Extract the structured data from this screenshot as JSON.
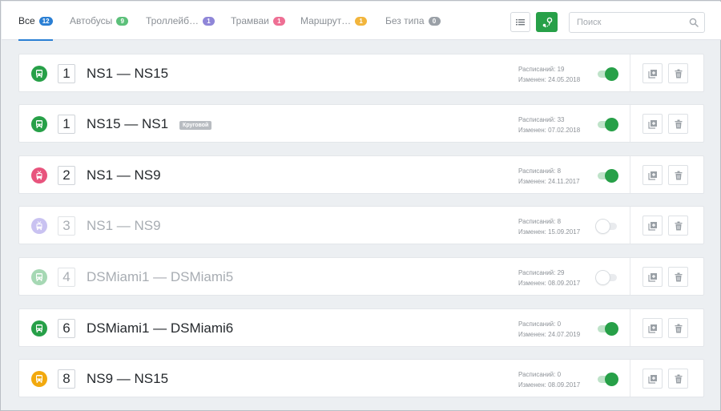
{
  "tabs": [
    {
      "label": "Все",
      "count": "12",
      "badge_color": "#2a7fd4",
      "active": true
    },
    {
      "label": "Автобусы",
      "count": "9",
      "badge_color": "#5cc07a",
      "active": false
    },
    {
      "label": "Троллейб…",
      "count": "1",
      "badge_color": "#8f86d8",
      "active": false
    },
    {
      "label": "Трамваи",
      "count": "1",
      "badge_color": "#ee6f94",
      "active": false
    },
    {
      "label": "Маршрут…",
      "count": "1",
      "badge_color": "#f2b53c",
      "active": false
    },
    {
      "label": "Без типа",
      "count": "0",
      "badge_color": "#9aa0a7",
      "active": false
    }
  ],
  "toolbar": {
    "list_icon": "list-icon",
    "map_icon": "route-map-icon",
    "accent": "#27a048"
  },
  "search": {
    "placeholder": "Поиск",
    "value": "",
    "icon": "search-icon"
  },
  "routes": [
    {
      "type_icon": "bus-icon",
      "type_color": "#27a048",
      "number": "1",
      "title": "NS1 — NS15",
      "tag": "",
      "schedules": "Расписаний: 19",
      "modified": "Изменен: 24.05.2018",
      "enabled": true
    },
    {
      "type_icon": "bus-icon",
      "type_color": "#27a048",
      "number": "1",
      "title": "NS15 — NS1",
      "tag": "Круговой",
      "schedules": "Расписаний: 33",
      "modified": "Изменен: 07.02.2018",
      "enabled": true
    },
    {
      "type_icon": "tram-icon",
      "type_color": "#e8547d",
      "number": "2",
      "title": "NS1 — NS9",
      "tag": "",
      "schedules": "Расписаний: 8",
      "modified": "Изменен: 24.11.2017",
      "enabled": true
    },
    {
      "type_icon": "trolleybus-icon",
      "type_color": "#9d92e6",
      "number": "3",
      "title": "NS1 — NS9",
      "tag": "",
      "schedules": "Расписаний: 8",
      "modified": "Изменен: 15.09.2017",
      "enabled": false
    },
    {
      "type_icon": "bus-icon",
      "type_color": "#5fba78",
      "number": "4",
      "title": "DSMiami1 — DSMiami5",
      "tag": "",
      "schedules": "Расписаний: 29",
      "modified": "Изменен: 08.09.2017",
      "enabled": false
    },
    {
      "type_icon": "bus-icon",
      "type_color": "#27a048",
      "number": "6",
      "title": "DSMiami1 — DSMiami6",
      "tag": "",
      "schedules": "Расписаний: 0",
      "modified": "Изменен: 24.07.2019",
      "enabled": true
    },
    {
      "type_icon": "minibus-icon",
      "type_color": "#f2a90e",
      "number": "8",
      "title": "NS9 — NS15",
      "tag": "",
      "schedules": "Расписаний: 0",
      "modified": "Изменен: 08.09.2017",
      "enabled": true
    }
  ],
  "row_actions": {
    "copy_icon": "copy-icon",
    "delete_icon": "trash-icon"
  }
}
